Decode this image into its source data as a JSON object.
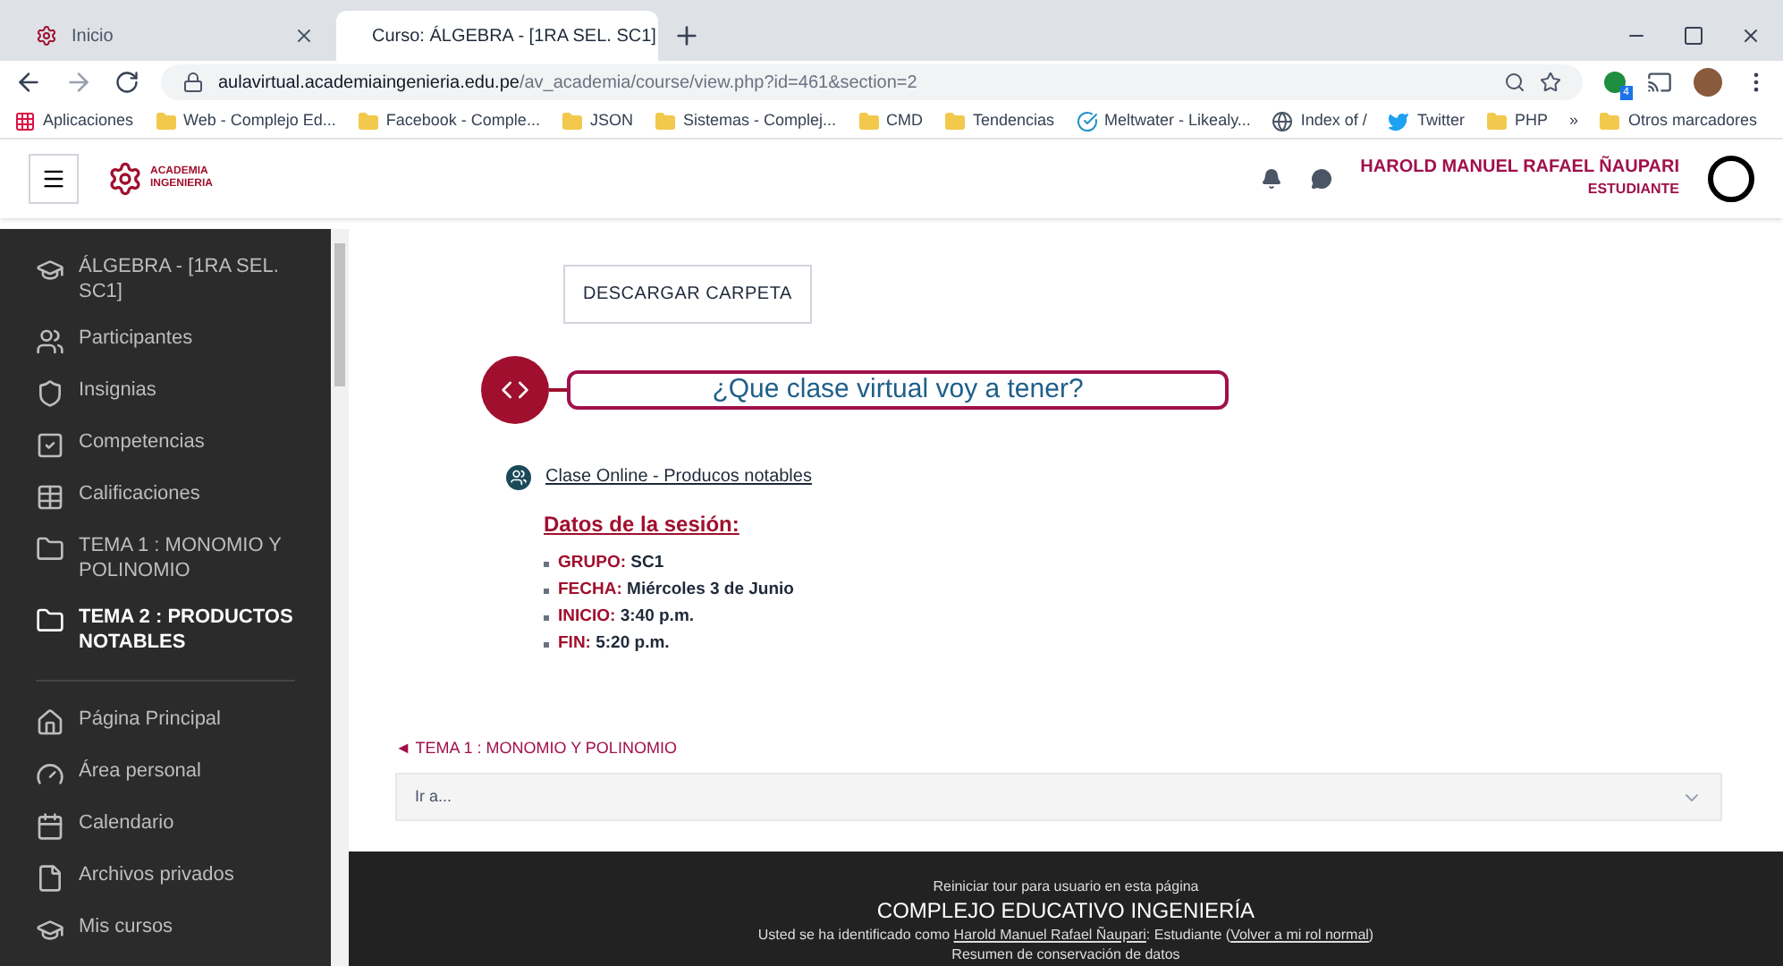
{
  "browser": {
    "tabs": [
      {
        "title": "Inicio",
        "selected": false
      },
      {
        "title": "Curso: ÁLGEBRA - [1RA SEL. SC1]",
        "selected": true
      }
    ],
    "url": {
      "host": "aulavirtual.academiaingenieria.edu.pe",
      "path": "/av_academia/course/view.php?id=461&section=2"
    },
    "bookmarks": [
      {
        "kind": "apps",
        "label": "Aplicaciones"
      },
      {
        "kind": "folder",
        "label": "Web - Complejo Ed..."
      },
      {
        "kind": "folder",
        "label": "Facebook - Comple..."
      },
      {
        "kind": "folder",
        "label": "JSON"
      },
      {
        "kind": "folder",
        "label": "Sistemas - Complej..."
      },
      {
        "kind": "folder",
        "label": "CMD"
      },
      {
        "kind": "folder",
        "label": "Tendencias"
      },
      {
        "kind": "check",
        "label": "Meltwater - Likealy..."
      },
      {
        "kind": "globe",
        "label": "Index of /"
      },
      {
        "kind": "bird",
        "label": "Twitter"
      },
      {
        "kind": "folder",
        "label": "PHP"
      },
      {
        "kind": "more",
        "label": "»"
      },
      {
        "kind": "folder",
        "label": "Otros marcadores"
      }
    ],
    "extension_badge": "4"
  },
  "header": {
    "logo_text": [
      "ACADEMIA",
      "INGENIERIA"
    ],
    "user_name": "HAROLD MANUEL RAFAEL ÑAUPARI",
    "user_role": "ESTUDIANTE"
  },
  "sidebar": {
    "course_items": [
      {
        "label": "ÁLGEBRA - [1RA SEL. SC1]",
        "selected": false
      },
      {
        "label": "Participantes",
        "selected": false
      },
      {
        "label": "Insignias",
        "selected": false
      },
      {
        "label": "Competencias",
        "selected": false
      },
      {
        "label": "Calificaciones",
        "selected": false
      },
      {
        "label": "TEMA 1 : MONOMIO Y POLINOMIO",
        "selected": false
      },
      {
        "label": "TEMA 2 : PRODUCTOS NOTABLES",
        "selected": true
      }
    ],
    "site_items": [
      {
        "label": "Página Principal",
        "selected": false
      },
      {
        "label": "Área personal",
        "selected": false
      },
      {
        "label": "Calendario",
        "selected": false
      },
      {
        "label": "Archivos privados",
        "selected": false
      },
      {
        "label": "Mis cursos",
        "selected": false
      }
    ]
  },
  "content": {
    "download_button": "DESCARGAR CARPETA",
    "banner_title": "¿Que clase virtual voy a tener?",
    "link": "Clase Online - Producos notables",
    "session_heading": "Datos de la sesión:",
    "session_items": [
      {
        "label": "GRUPO:",
        "value": "SC1"
      },
      {
        "label": "FECHA:",
        "value": "Miércoles 3 de Junio"
      },
      {
        "label": "INICIO:",
        "value": "3:40 p.m."
      },
      {
        "label": "FIN:",
        "value": "5:20 p.m."
      }
    ],
    "prev_section": "◄ TEMA 1 : MONOMIO Y POLINOMIO",
    "jump_select": {
      "value": "Ir a..."
    }
  },
  "footer": {
    "tour_link": "Reiniciar tour para usuario en esta página",
    "title": "COMPLEJO EDUCATIVO INGENIERÍA",
    "login_prefix": "Usted se ha identificado como",
    "login_name": "Harold Manuel Rafael Ñaupari",
    "login_middle": ": Estudiante (",
    "login_role_link": "Volver a mi rol normal",
    "login_suffix": ")",
    "data_link": "Resumen de conservación de datos"
  }
}
